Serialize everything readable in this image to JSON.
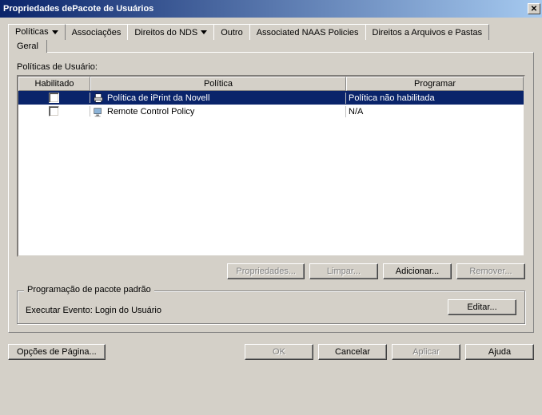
{
  "window": {
    "title": "Propriedades dePacote de Usuários"
  },
  "tabs": {
    "politicas": "Políticas",
    "associacoes": "Associações",
    "direitos_nds": "Direitos do NDS",
    "outro": "Outro",
    "naas": "Associated NAAS Policies",
    "arquivos": "Direitos a Arquivos e Pastas",
    "subtab_geral": "Geral"
  },
  "section": {
    "label_politicas": "Políticas de Usuário:"
  },
  "grid": {
    "headers": {
      "habilitado": "Habilitado",
      "politica": "Política",
      "programar": "Programar"
    },
    "rows": [
      {
        "policy": "Política de iPrint da Novell",
        "schedule": "Política não habilitada"
      },
      {
        "policy": "Remote Control Policy",
        "schedule": "N/A"
      }
    ]
  },
  "buttons": {
    "propriedades": "Propriedades...",
    "limpar": "Limpar...",
    "adicionar": "Adicionar...",
    "remover": "Remover...",
    "editar": "Editar...",
    "opcoes_pagina": "Opções de Página...",
    "ok": "OK",
    "cancelar": "Cancelar",
    "aplicar": "Aplicar",
    "ajuda": "Ajuda"
  },
  "schedule_group": {
    "title": "Programação de pacote padrão",
    "event_label": "Executar Evento: Login do Usuário"
  }
}
